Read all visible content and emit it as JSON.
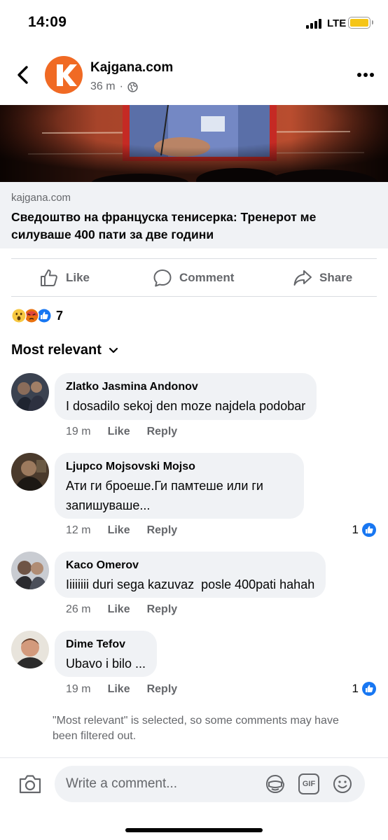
{
  "status_bar": {
    "time": "14:09",
    "network": "LTE"
  },
  "header": {
    "page_name": "Kajgana.com",
    "time_ago": "36 m",
    "separator": "·"
  },
  "link_preview": {
    "domain": "kajgana.com",
    "title": "Сведоштво на француска тенисерка: Тренерот ме силуваше 400 пати за две години"
  },
  "actions": {
    "like": "Like",
    "comment": "Comment",
    "share": "Share"
  },
  "reactions": {
    "icons": [
      "wow-reaction",
      "angry-reaction",
      "like-reaction"
    ],
    "count": "7"
  },
  "sort": {
    "label": "Most relevant"
  },
  "comments": [
    {
      "name": "Zlatko Jasmina Andonov",
      "text": "I dosadilo sekoj den moze najdela podobar",
      "time": "19 m",
      "like": "Like",
      "reply": "Reply",
      "likes": ""
    },
    {
      "name": "Ljupco Mojsovski Mojso",
      "text": "Ати ги броеше.Ги памтеше или ги запишуваше...",
      "time": "12 m",
      "like": "Like",
      "reply": "Reply",
      "likes": "1"
    },
    {
      "name": "Kaco Omerov",
      "text": "Iiiiiiii duri sega kazuvaz  posle 400pati hahah",
      "time": "26 m",
      "like": "Like",
      "reply": "Reply",
      "likes": ""
    },
    {
      "name": "Dime Tefov",
      "text": "Ubavo i bilo ...",
      "time": "19 m",
      "like": "Like",
      "reply": "Reply",
      "likes": "1"
    }
  ],
  "filter_note": "\"Most relevant\" is selected, so some comments may have been filtered out.",
  "composer": {
    "placeholder": "Write a comment...",
    "gif_label": "GIF"
  },
  "colors": {
    "brand": "#f06a24",
    "fb_blue": "#1877f2",
    "secondary_text": "#65676b",
    "bubble": "#f0f2f5"
  }
}
